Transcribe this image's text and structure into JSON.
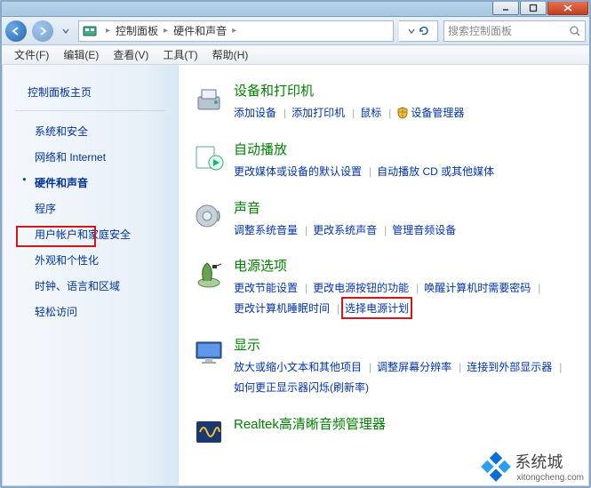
{
  "breadcrumb": {
    "root_icon": "control-panel",
    "part1": "控制面板",
    "part2": "硬件和声音"
  },
  "search": {
    "placeholder": "搜索控制面板"
  },
  "menu": {
    "file": "文件(F)",
    "edit": "编辑(E)",
    "view": "查看(V)",
    "tools": "工具(T)",
    "help": "帮助(H)"
  },
  "sidebar": {
    "home": "控制面板主页",
    "items": [
      "系统和安全",
      "网络和 Internet",
      "硬件和声音",
      "程序",
      "用户帐户和家庭安全",
      "外观和个性化",
      "时钟、语言和区域",
      "轻松访问"
    ],
    "active_index": 2
  },
  "sections": [
    {
      "icon": "printer",
      "title": "设备和打印机",
      "links": [
        "添加设备",
        "添加打印机",
        "鼠标"
      ],
      "trailing_shield_link": "设备管理器"
    },
    {
      "icon": "autoplay",
      "title": "自动播放",
      "links": [
        "更改媒体或设备的默认设置",
        "自动播放 CD 或其他媒体"
      ]
    },
    {
      "icon": "sound",
      "title": "声音",
      "links": [
        "调整系统音量",
        "更改系统声音",
        "管理音频设备"
      ]
    },
    {
      "icon": "power",
      "title": "电源选项",
      "links": [
        "更改节能设置",
        "更改电源按钮的功能",
        "唤醒计算机时需要密码",
        "更改计算机睡眠时间",
        "选择电源计划"
      ]
    },
    {
      "icon": "display",
      "title": "显示",
      "links": [
        "放大或缩小文本和其他项目",
        "调整屏幕分辨率",
        "连接到外部显示器",
        "如何更正显示器闪烁(刷新率)"
      ]
    },
    {
      "icon": "realtek",
      "title": "Realtek高清晰音频管理器",
      "links": []
    }
  ],
  "watermark": {
    "brand": "系统城",
    "url": "xitongcheng.com"
  }
}
